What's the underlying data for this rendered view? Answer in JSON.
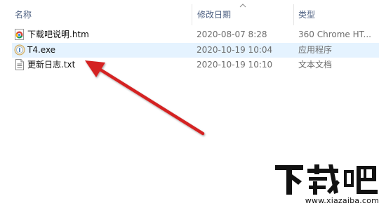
{
  "columns": {
    "name": "名称",
    "date": "修改日期",
    "type": "类型"
  },
  "files": [
    {
      "name": "下载吧说明.htm",
      "date": "2020-08-07 8:28",
      "type": "360 Chrome HT...",
      "icon": "chrome-html-icon",
      "selected": false
    },
    {
      "name": "T4.exe",
      "date": "2020-10-19 10:04",
      "type": "应用程序",
      "icon": "app-icon",
      "selected": true
    },
    {
      "name": "更新日志.txt",
      "date": "2020-10-19 10:10",
      "type": "文本文档",
      "icon": "text-file-icon",
      "selected": false
    }
  ],
  "annotation": {
    "color": "#d42222"
  },
  "watermark": {
    "url": "www.xiazaiba.com"
  },
  "colors": {
    "header_text": "#4d6082",
    "selection": "#e5f3ff",
    "detail_text": "#6d6d6d"
  }
}
